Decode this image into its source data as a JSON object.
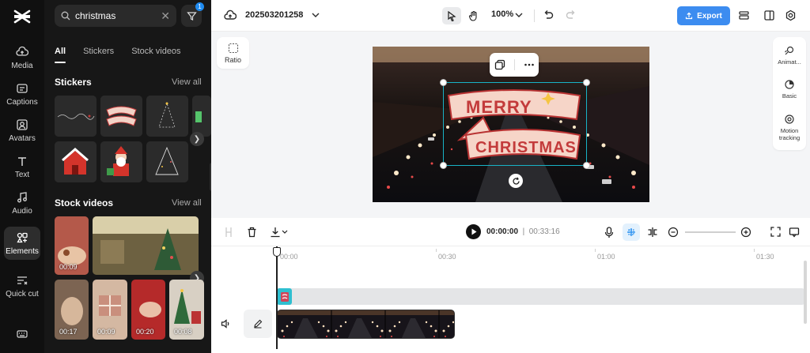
{
  "rail": {
    "items": [
      {
        "label": "Media",
        "icon": "cloud-upload-icon"
      },
      {
        "label": "Captions",
        "icon": "captions-icon"
      },
      {
        "label": "Avatars",
        "icon": "avatar-icon"
      },
      {
        "label": "Text",
        "icon": "text-icon"
      },
      {
        "label": "Audio",
        "icon": "music-note-icon"
      },
      {
        "label": "Elements",
        "icon": "elements-icon"
      },
      {
        "label": "Quick cut",
        "icon": "quick-cut-icon"
      }
    ],
    "active": "Elements"
  },
  "panel": {
    "search": {
      "value": "christmas",
      "placeholder": "Search"
    },
    "filter_badge": "1",
    "tabs": [
      "All",
      "Stickers",
      "Stock videos"
    ],
    "active_tab": "All",
    "stickers": {
      "title": "Stickers",
      "view_all": "View all"
    },
    "stock_videos": {
      "title": "Stock videos",
      "view_all": "View all",
      "durations": [
        "00:09",
        "00:17",
        "00:09",
        "00:20",
        "00:08"
      ]
    }
  },
  "topbar": {
    "project_name": "202503201258",
    "zoom": "100%",
    "export_label": "Export"
  },
  "workspace": {
    "ratio_label": "Ratio",
    "sticker_text": [
      "MERRY",
      "CHRISTMAS"
    ],
    "right_tools": [
      "Animat...",
      "Basic",
      "Motion tracking"
    ]
  },
  "timeline": {
    "current_time": "00:00:00",
    "total_time": "00:33:16",
    "ruler": [
      "00:00",
      "00:30",
      "01:00",
      "01:30"
    ]
  },
  "colors": {
    "accent": "#3c8cf0",
    "selection": "#18b3c6",
    "rail_bg": "#101010",
    "panel_bg": "#171717"
  }
}
